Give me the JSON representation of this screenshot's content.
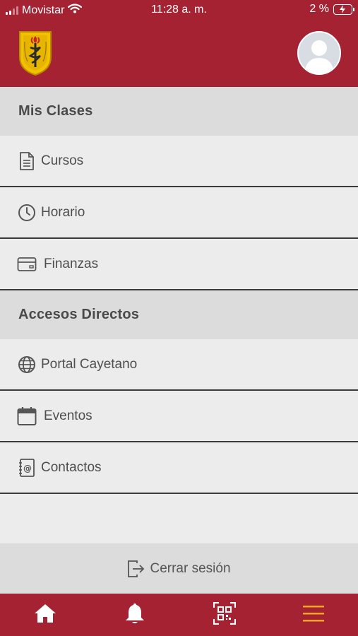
{
  "status": {
    "carrier": "Movistar",
    "time": "11:28 a. m.",
    "battery": "2 %"
  },
  "menu": {
    "section1": "Mis Clases",
    "items1": [
      {
        "label": "Cursos",
        "icon": "document-icon"
      },
      {
        "label": "Horario",
        "icon": "clock-icon"
      },
      {
        "label": "Finanzas",
        "icon": "credit-card-icon"
      }
    ],
    "section2": "Accesos Directos",
    "items2": [
      {
        "label": "Portal Cayetano",
        "icon": "globe-icon"
      },
      {
        "label": "Eventos",
        "icon": "calendar-icon"
      },
      {
        "label": "Contactos",
        "icon": "address-book-icon"
      }
    ]
  },
  "logout": {
    "label": "Cerrar sesión"
  },
  "colors": {
    "brand": "#a52233",
    "accent": "#f5a623"
  }
}
